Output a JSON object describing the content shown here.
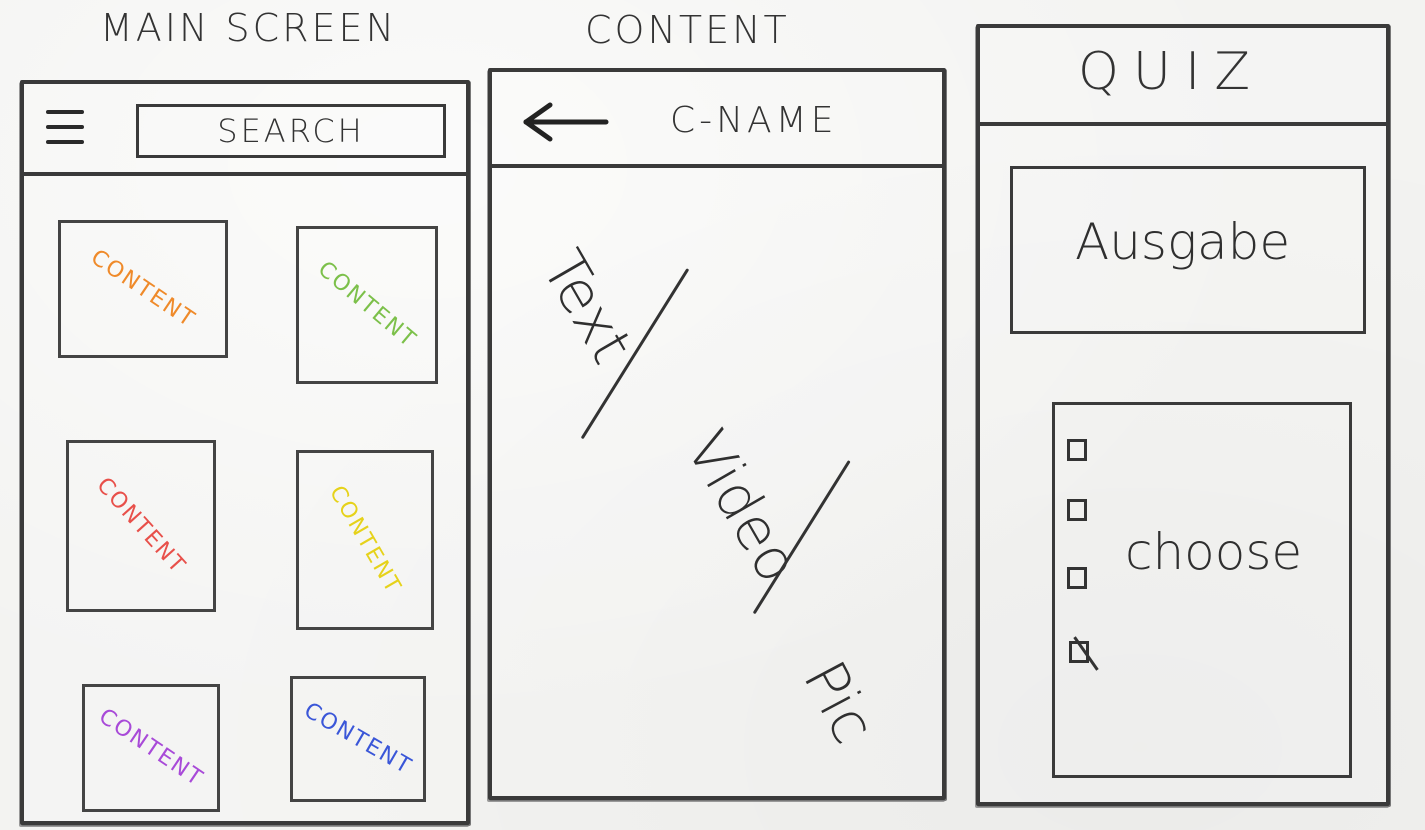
{
  "screens": {
    "main": {
      "title": "MAIN SCREEN",
      "search_label": "SEARCH",
      "tiles": [
        {
          "label": "CONTENT",
          "color": "#ef8a2a"
        },
        {
          "label": "CONTENT",
          "color": "#7cc04a"
        },
        {
          "label": "CONTENT",
          "color": "#e8504a"
        },
        {
          "label": "CONTENT",
          "color": "#f2e02c"
        },
        {
          "label": "CONTENT",
          "color": "#a84ad8"
        },
        {
          "label": "CONTENT",
          "color": "#3a56d8"
        }
      ]
    },
    "content": {
      "title": "CONTENT",
      "header_name": "C-NAME",
      "parts": [
        "Text",
        "Video",
        "Pic"
      ]
    },
    "quiz": {
      "title": "QUIZ",
      "output_label": "Ausgabe",
      "choose_label": "choose",
      "options": [
        {
          "checked": false
        },
        {
          "checked": false
        },
        {
          "checked": false
        },
        {
          "checked": true
        }
      ]
    }
  },
  "icons": {
    "menu": "hamburger-menu-icon",
    "back": "back-arrow-icon",
    "checkbox": "checkbox-icon"
  }
}
